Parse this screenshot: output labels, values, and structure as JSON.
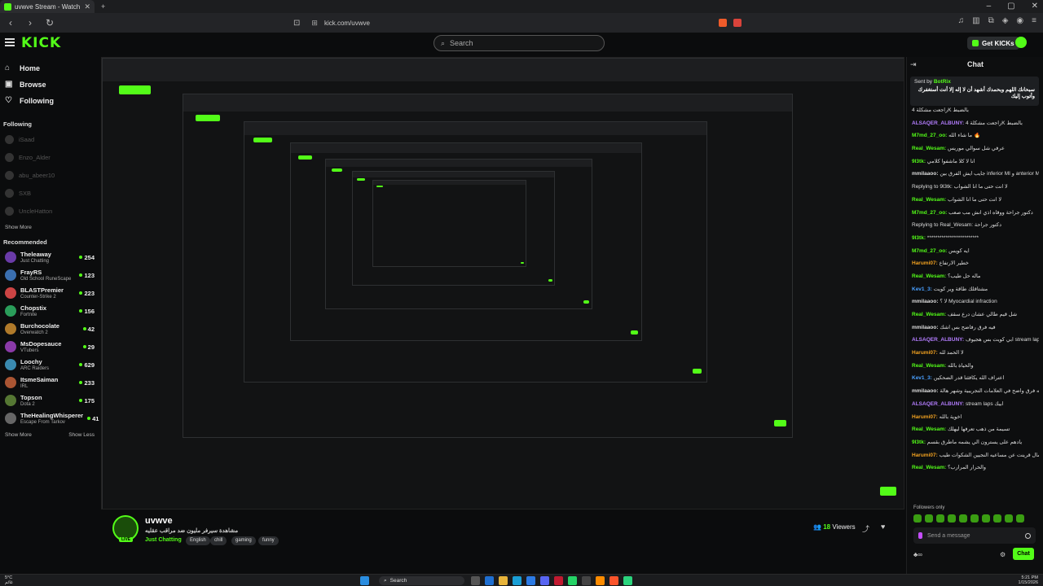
{
  "browser": {
    "tab_title": "uvwve Stream - Watch Live on K",
    "url": "kick.com/uvwve"
  },
  "header": {
    "logo": "KICK",
    "search_placeholder": "Search",
    "get_kicks": "Get KICKs"
  },
  "sidebar": {
    "nav": [
      {
        "label": "Home",
        "icon": "home-icon"
      },
      {
        "label": "Browse",
        "icon": "compass-icon"
      },
      {
        "label": "Following",
        "icon": "heart-icon"
      }
    ],
    "following_heading": "Following",
    "following": [
      "iSaad",
      "Enzo_Alder",
      "abu_abeer10",
      "SXB",
      "UncleHatton"
    ],
    "show_more": "Show More",
    "recommended_heading": "Recommended",
    "recommended": [
      {
        "name": "Theleaway",
        "category": "Just Chatting",
        "viewers": "254"
      },
      {
        "name": "FrayRS",
        "category": "Old School RuneScape",
        "viewers": "123"
      },
      {
        "name": "BLASTPremier",
        "category": "Counter-Strike 2",
        "viewers": "223"
      },
      {
        "name": "Chopstix",
        "category": "Fortnite",
        "viewers": "156"
      },
      {
        "name": "Burchocolate",
        "category": "Overwatch 2",
        "viewers": "42"
      },
      {
        "name": "MsDopesauce",
        "category": "VTubers",
        "viewers": "29"
      },
      {
        "name": "Loochy",
        "category": "ARC Raiders",
        "viewers": "629"
      },
      {
        "name": "ItsmeSaiman",
        "category": "IRL",
        "viewers": "233"
      },
      {
        "name": "Topson",
        "category": "Dota 2",
        "viewers": "175"
      },
      {
        "name": "TheHealingWhisperer",
        "category": "Escape From Tarkov",
        "viewers": "41"
      }
    ],
    "show_more2": "Show More",
    "show_less": "Show Less"
  },
  "stream": {
    "name": "uvwve",
    "title": "مشاهدة سيرفر مليون ضد مراقب عقليه",
    "category": "Just Chatting",
    "tags": [
      "English",
      "chill",
      "gaming",
      "funny"
    ],
    "live": "LIVE",
    "viewers_count": "18",
    "viewers_label": "Viewers"
  },
  "chat": {
    "title": "Chat",
    "pinned_sent_by": "Sent by",
    "pinned_user": "BotRix",
    "pinned_text": "سبحانك اللهم وبحمدك أشهد أن لا إله إلا أنت أستغفرك وأتوب إليك",
    "messages": [
      {
        "user": "",
        "text": "راجعت مشكلة 4K بالضبط",
        "color": "#ddd"
      },
      {
        "user": "ALSAQER_ALBUNY:",
        "text": "راجعت مشكلة 4K بالضبط",
        "color": "#b47dff"
      },
      {
        "user": "M7md_27_oo:",
        "text": "ما شاء الله 🔥",
        "color": "#53fc18"
      },
      {
        "user": "Real_Wesam:",
        "text": "عرفي شل سوالي موريس",
        "color": "#53fc18"
      },
      {
        "user": "9l3tk:",
        "text": "انا لا كلا ماشفوا كلامي",
        "color": "#53fc18"
      },
      {
        "user": "mmilaaoo:",
        "text": "جايب ايش الفرق بين inferior MI و anterior MI",
        "color": "#ddd"
      },
      {
        "user": "",
        "text": "Replying to 9l3tk: لا انت حتى ما انا الشواب",
        "color": "#777"
      },
      {
        "user": "Real_Wesam:",
        "text": "لا انت حتى ما انا الشواب",
        "color": "#53fc18"
      },
      {
        "user": "M7md_27_oo:",
        "text": "دكتور جراحة ووقاه اذي انش مب صعب",
        "color": "#53fc18"
      },
      {
        "user": "",
        "text": "Replying to Real_Wesam: دكتور جراحة",
        "color": "#777"
      },
      {
        "user": "9l3tk:",
        "text": "*************************",
        "color": "#53fc18"
      },
      {
        "user": "M7md_27_oo:",
        "text": "ايه كويس",
        "color": "#53fc18"
      },
      {
        "user": "Harumi07:",
        "text": "خطير الارتفاع",
        "color": "#f0a020"
      },
      {
        "user": "Real_Wesam:",
        "text": "ماله حل طيب؟",
        "color": "#53fc18"
      },
      {
        "user": "Kev1_3:",
        "text": "مشتاقلك طاقة وير كويت",
        "color": "#4aa0ff"
      },
      {
        "user": "mmilaaoo:",
        "text": "لا ؟ Myocardial infraction",
        "color": "#ddd"
      },
      {
        "user": "Real_Wesam:",
        "text": "شل قيم طالي عشان درع سقف",
        "color": "#53fc18"
      },
      {
        "user": "mmilaaoo:",
        "text": "فيه فرق رفاضح بس اشك",
        "color": "#ddd"
      },
      {
        "user": "ALSAQER_ALBUNY:",
        "text": "ابي كويت بس هجيوف stream laps ops لا",
        "color": "#b47dff"
      },
      {
        "user": "Harumi07:",
        "text": "لا الحمد لله",
        "color": "#f0a020"
      },
      {
        "user": "Real_Wesam:",
        "text": "والحياة بالله",
        "color": "#53fc18"
      },
      {
        "user": "Kev1_3:",
        "text": "اعتراف الله يكافئنا قدر الضحكين",
        "color": "#4aa0ff"
      },
      {
        "user": "mmilaaoo:",
        "text": "فيه فرق واضح في العلامات التجريبية وشهر هالة",
        "color": "#ddd"
      },
      {
        "user": "ALSAQER_ALBUNY:",
        "text": "stream laps ابيك",
        "color": "#b47dff"
      },
      {
        "user": "Harumi07:",
        "text": "اخوية بالله",
        "color": "#f0a020"
      },
      {
        "user": "Real_Wesam:",
        "text": "تسيمة من ذهب تعرفها ليهلك",
        "color": "#53fc18"
      },
      {
        "user": "9l3tk:",
        "text": "يادهم على يسترون الي يشمه ماطرق بقسم",
        "color": "#53fc18"
      },
      {
        "user": "Harumi07:",
        "text": "أسأل قرينت عن مساعيه النجيين الشكوات طيب",
        "color": "#f0a020"
      },
      {
        "user": "Real_Wesam:",
        "text": "والحرار المرارب؟",
        "color": "#53fc18"
      }
    ],
    "followers_only": "Followers only",
    "input_placeholder": "Send a message",
    "send": "Chat"
  },
  "taskbar": {
    "temp": "5°C",
    "weather": "غائم",
    "search": "Search",
    "time": "5:21 PM",
    "date": "1/15/2026"
  }
}
